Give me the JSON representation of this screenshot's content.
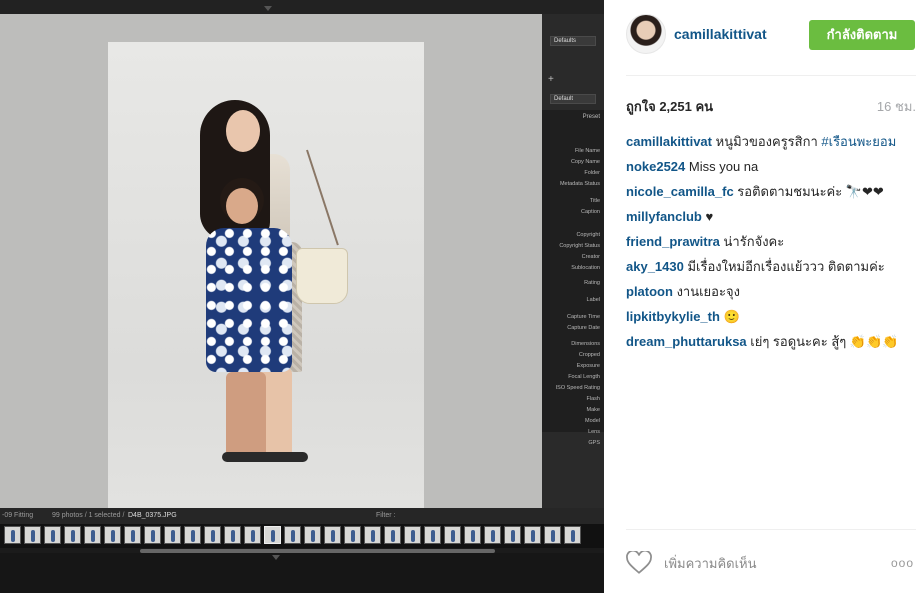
{
  "photo": {
    "panel": {
      "preset_default_1": "Defaults",
      "preset_default_2": "Default",
      "preset_header": "Preset",
      "metadata_labels": [
        "File Name",
        "Copy Name",
        "Folder",
        "Metadata Status",
        "Title",
        "Caption",
        "Copyright",
        "Copyright Status",
        "Creator",
        "Sublocation",
        "Rating",
        "Label",
        "Capture Time",
        "Capture Date",
        "Dimensions",
        "Cropped",
        "Exposure",
        "Focal Length",
        "ISO Speed Rating",
        "Flash",
        "Make",
        "Model",
        "Lens",
        "GPS"
      ]
    },
    "status": {
      "fitting": "-09 Fitting",
      "count": "99 photos / 1 selected /",
      "filename": "D4B_0375.JPG",
      "filter_label": "Filter :"
    }
  },
  "post": {
    "username": "camillakittivat",
    "follow_label": "กำลังติดตาม",
    "likes": "ถูกใจ 2,251 คน",
    "time": "16 ชม.",
    "caption_user": "camillakittivat",
    "caption_text": "หนูมิวของครูรสิกา",
    "caption_tag": "#เรือนพะยอม",
    "comments": [
      {
        "user": "noke2524",
        "text": "Miss you na"
      },
      {
        "user": "nicole_camilla_fc",
        "text": "รอติดตามชมนะค่ะ 🔭❤❤"
      },
      {
        "user": "millyfanclub",
        "text": "♥"
      },
      {
        "user": "friend_prawitra",
        "text": "น่ารักจังคะ"
      },
      {
        "user": "aky_1430",
        "text": "มีเรื่องใหม่อีกเรื่องแย้ววว ติดตามค่ะ"
      },
      {
        "user": "platoon",
        "text": "งานเยอะจุง"
      },
      {
        "user": "lipkitbykylie_th",
        "text": "🙂"
      },
      {
        "user": "dream_phuttaruksa",
        "text": "เย่ๆ รอดูนะคะ สู้ๆ 👏👏👏"
      }
    ],
    "add_comment_placeholder": "เพิ่มความคิดเห็น",
    "more_label": "ooo"
  },
  "colors": {
    "follow_button": "#6bbd40",
    "username": "#125688"
  }
}
